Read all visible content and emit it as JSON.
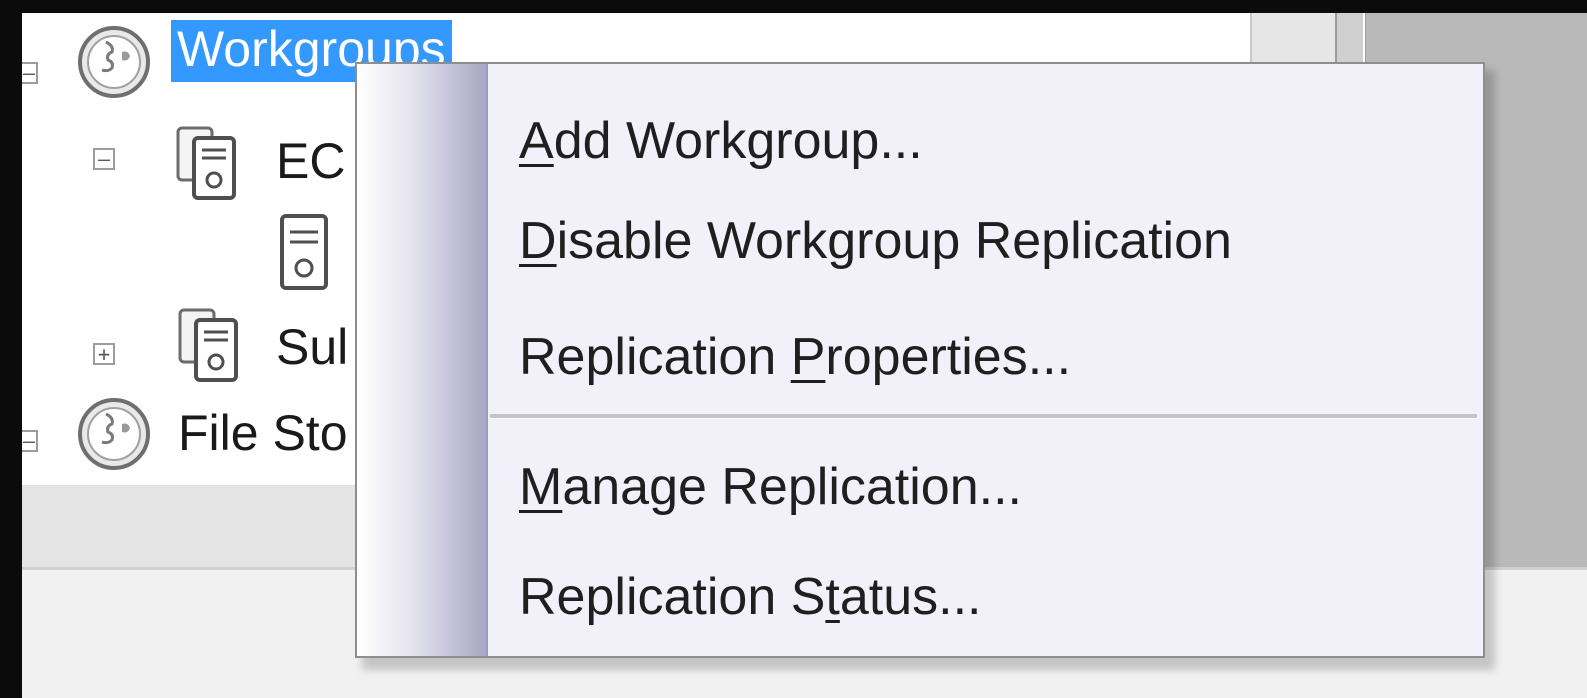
{
  "tree": {
    "items": [
      {
        "label": "Workgroups",
        "icon": "globe-icon",
        "visible_label": "Workgroups",
        "selected": true
      },
      {
        "label": "EC",
        "icon": "server-group-icon"
      },
      {
        "label": "",
        "icon": "server-icon"
      },
      {
        "label": "Sul",
        "icon": "server-group-icon"
      },
      {
        "label": "File Sto",
        "icon": "globe-icon"
      }
    ]
  },
  "context_menu": {
    "items": [
      {
        "pre": "",
        "mn": "A",
        "post": "dd Workgroup..."
      },
      {
        "pre": "",
        "mn": "D",
        "post": "isable Workgroup Replication"
      },
      {
        "pre": "Replication ",
        "mn": "P",
        "post": "roperties..."
      },
      {
        "pre": "",
        "mn": "M",
        "post": "anage Replication..."
      },
      {
        "pre": "Replication S",
        "mn": "t",
        "post": "atus..."
      }
    ]
  },
  "colors": {
    "selection": "#3399ff",
    "menu_background": "#f2f1f9"
  }
}
